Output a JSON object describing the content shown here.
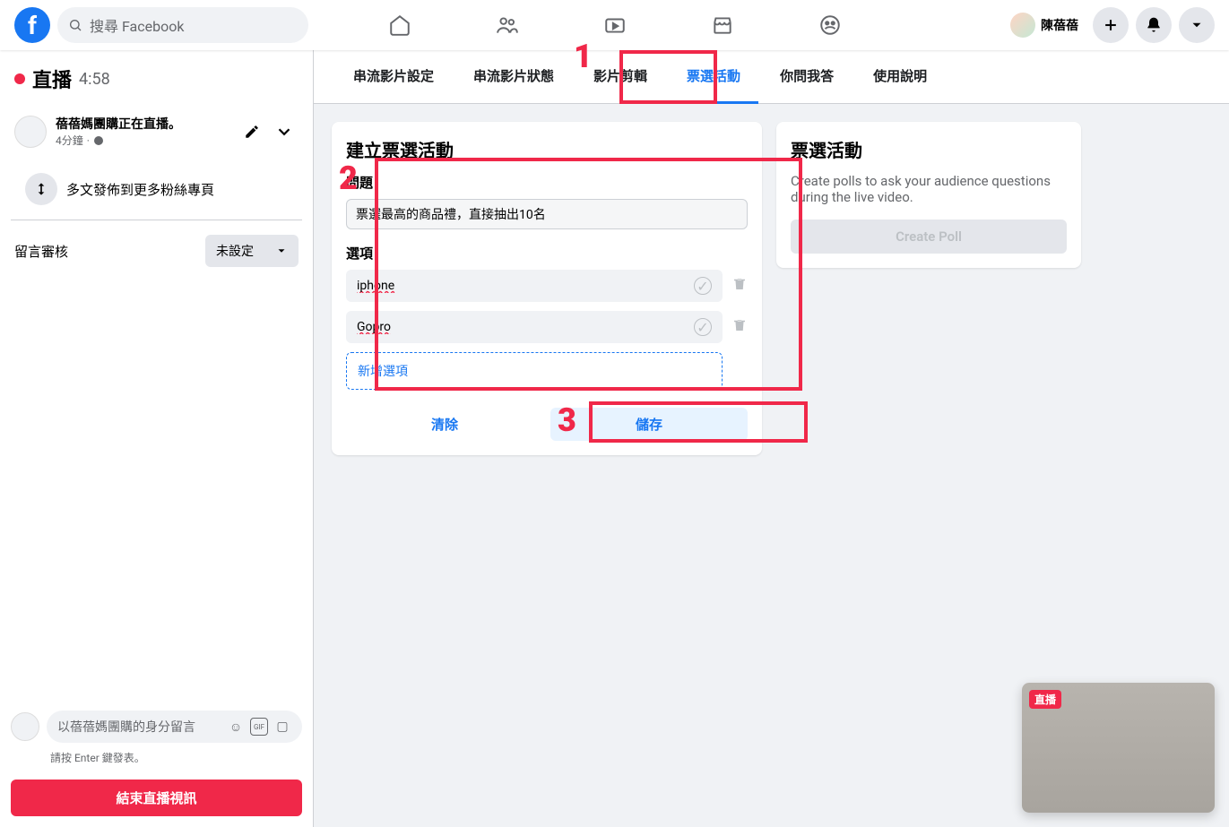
{
  "header": {
    "search_placeholder": "搜尋 Facebook",
    "user_name": "陳蓓蓓"
  },
  "sidebar": {
    "live_label": "直播",
    "live_time": "4:58",
    "stream_title": "蓓蓓媽團購正在直播。",
    "stream_meta": "4分鐘",
    "crosspost_label": "多文發佈到更多粉絲專頁",
    "comment_review_label": "留言審核",
    "comment_review_value": "未設定",
    "comment_placeholder": "以蓓蓓媽團購的身分留言",
    "comment_hint": "請按 Enter 鍵發表。",
    "end_button": "結束直播視訊"
  },
  "tabs": [
    "串流影片設定",
    "串流影片狀態",
    "影片剪輯",
    "票選活動",
    "你問我答",
    "使用說明"
  ],
  "active_tab_index": 3,
  "poll_form": {
    "title": "建立票選活動",
    "question_label": "問題",
    "question_value": "票選最高的商品禮，直接抽出10名",
    "options_label": "選項",
    "options": [
      "iphone",
      "Gopro"
    ],
    "add_option_label": "新增選項",
    "clear_btn": "清除",
    "save_btn": "儲存"
  },
  "poll_side": {
    "title": "票選活動",
    "description": "Create polls to ask your audience questions during the live video.",
    "create_btn": "Create Poll"
  },
  "video_preview": {
    "badge": "直播"
  },
  "annotations": {
    "num1": "1",
    "num2": "2",
    "num3": "3"
  }
}
